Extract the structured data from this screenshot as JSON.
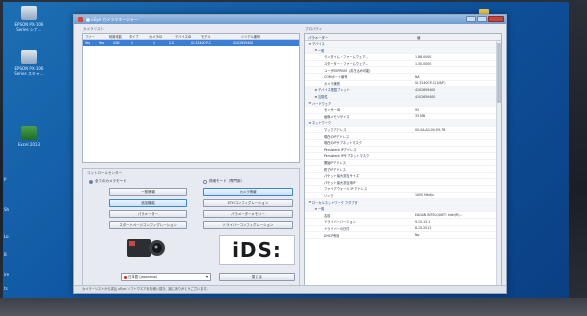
{
  "desktop": {
    "icons": [
      {
        "caption_1": "EPSON PX-106",
        "caption_2": "Series シナ..."
      },
      {
        "caption_1": "EPSON PX-106",
        "caption_2": "Series スキャ..."
      },
      {
        "caption_1": "Excel 2013",
        "caption_2": ""
      }
    ],
    "edge_labels": [
      "P",
      "Sh",
      "Lo",
      "B",
      "ire",
      "ts"
    ]
  },
  "window": {
    "title": "■ uEye カメラマネージャー"
  },
  "camera_list": {
    "group_label": "カメラリスト",
    "columns": [
      "フリー",
      "利用可能",
      "タイプ",
      "カメラID",
      "デバイスID",
      "モデル",
      "シリアル番号"
    ],
    "rows": [
      [
        "Yes",
        "Yes",
        "USB",
        "1",
        "1",
        "2.0",
        "UI-3240CP-C",
        "4102659400"
      ]
    ]
  },
  "settings": {
    "group_label": "コントロールセンター",
    "radio_left": "全てのカメラモード",
    "radio_right": "詳細モード（専門用）",
    "buttons": {
      "general_info": "一般情報",
      "camera_info": "カメラ情報",
      "additional_functions": "追加機能",
      "eth_config": "ETHコンフィグレーション",
      "parameter": "パラメーター",
      "param_mem": "パラメーターメモリー",
      "start_config": "スタートページコンフィグレーション",
      "driver_config": "ドライバーコンフィグレーション",
      "close": "閉じる"
    },
    "logo_text": "iDS:",
    "language": "日本語 (Japanese)"
  },
  "properties": {
    "group_label": "プロパティ",
    "columns": [
      "パラメーター",
      "値"
    ],
    "rows": [
      {
        "level": 0,
        "exp": "⊟",
        "key": "デバイス",
        "value": "",
        "cat": true
      },
      {
        "level": 1,
        "exp": "⊟",
        "key": "一般",
        "value": "",
        "cat": true
      },
      {
        "level": 2,
        "exp": "",
        "key": "ランタイム・ファームウェア...",
        "value": "1.88.0000",
        "cat": false
      },
      {
        "level": 2,
        "exp": "",
        "key": "スターター・ファームウェア...",
        "value": "1.30.0000",
        "cat": false
      },
      {
        "level": 2,
        "exp": "",
        "key": "ユーザEEPROM（書き込み可能）",
        "value": "",
        "cat": false
      },
      {
        "level": 2,
        "exp": "",
        "key": "COMポート番号",
        "value": "NA",
        "cat": false
      },
      {
        "level": 2,
        "exp": "",
        "key": "カメラ識別",
        "value": "UI-3240CP-C(1/6/F)",
        "cat": false
      },
      {
        "level": 1,
        "exp": "⊞",
        "key": "デバイス搭載ブレット",
        "value": "4102659400",
        "cat": true
      },
      {
        "level": 1,
        "exp": "⊞",
        "key": "互換性",
        "value": "4102659400",
        "cat": true
      },
      {
        "level": 0,
        "exp": "⊟",
        "key": "ハードウェア",
        "value": "",
        "cat": true
      },
      {
        "level": 2,
        "exp": "",
        "key": "センサーID",
        "value": "93",
        "cat": false
      },
      {
        "level": 2,
        "exp": "",
        "key": "画像メモリサイズ",
        "value": "33 MB",
        "cat": false
      },
      {
        "level": 0,
        "exp": "⊟",
        "key": "ネットワーク",
        "value": "",
        "cat": true
      },
      {
        "level": 2,
        "exp": "",
        "key": "マックアドレス",
        "value": "00-0A-A0-00-E9-7B",
        "cat": false
      },
      {
        "level": 2,
        "exp": "",
        "key": "現在のIPアドレス",
        "value": "",
        "cat": false
      },
      {
        "level": 2,
        "exp": "",
        "key": "現在のIPサブネットマスク",
        "value": "",
        "cat": false
      },
      {
        "level": 2,
        "exp": "",
        "key": "Persistent IPアドレス",
        "value": "",
        "cat": false
      },
      {
        "level": 2,
        "exp": "",
        "key": "Persistent IPサブネットマスク",
        "value": "",
        "cat": false
      },
      {
        "level": 2,
        "exp": "",
        "key": "開始IPアドレス",
        "value": "",
        "cat": false
      },
      {
        "level": 2,
        "exp": "",
        "key": "終了IPアドレス",
        "value": "",
        "cat": false
      },
      {
        "level": 2,
        "exp": "",
        "key": "パケット最大割当サイズ",
        "value": "",
        "cat": false
      },
      {
        "level": 2,
        "exp": "",
        "key": "パケット最大割当用IP",
        "value": "",
        "cat": false
      },
      {
        "level": 2,
        "exp": "",
        "key": "ファイアウォール IP アドレス",
        "value": "",
        "cat": false
      },
      {
        "level": 2,
        "exp": "",
        "key": "リンク",
        "value": "1000 Mbit/s",
        "cat": false
      },
      {
        "level": 0,
        "exp": "⊟",
        "key": "ローカルネットワーク アダプタ",
        "value": "",
        "cat": true
      },
      {
        "level": 1,
        "exp": "⊟",
        "key": "一般",
        "value": "",
        "cat": true
      },
      {
        "level": 2,
        "exp": "",
        "key": "名前",
        "value": "EAGAN INTELQUIET: Intel(R)...",
        "cat": false
      },
      {
        "level": 2,
        "exp": "",
        "key": "ドライバーバージョン",
        "value": "9.15.13.1",
        "cat": false
      },
      {
        "level": 2,
        "exp": "",
        "key": "ドライバーの日付",
        "value": "8.15.2013",
        "cat": false
      },
      {
        "level": 2,
        "exp": "",
        "key": "DHCP有効",
        "value": "No",
        "cat": false
      }
    ]
  },
  "status": "カメラーリストから書込 uEye-ソフトウエアをお使い頂き、誠にありがとうございます。"
}
